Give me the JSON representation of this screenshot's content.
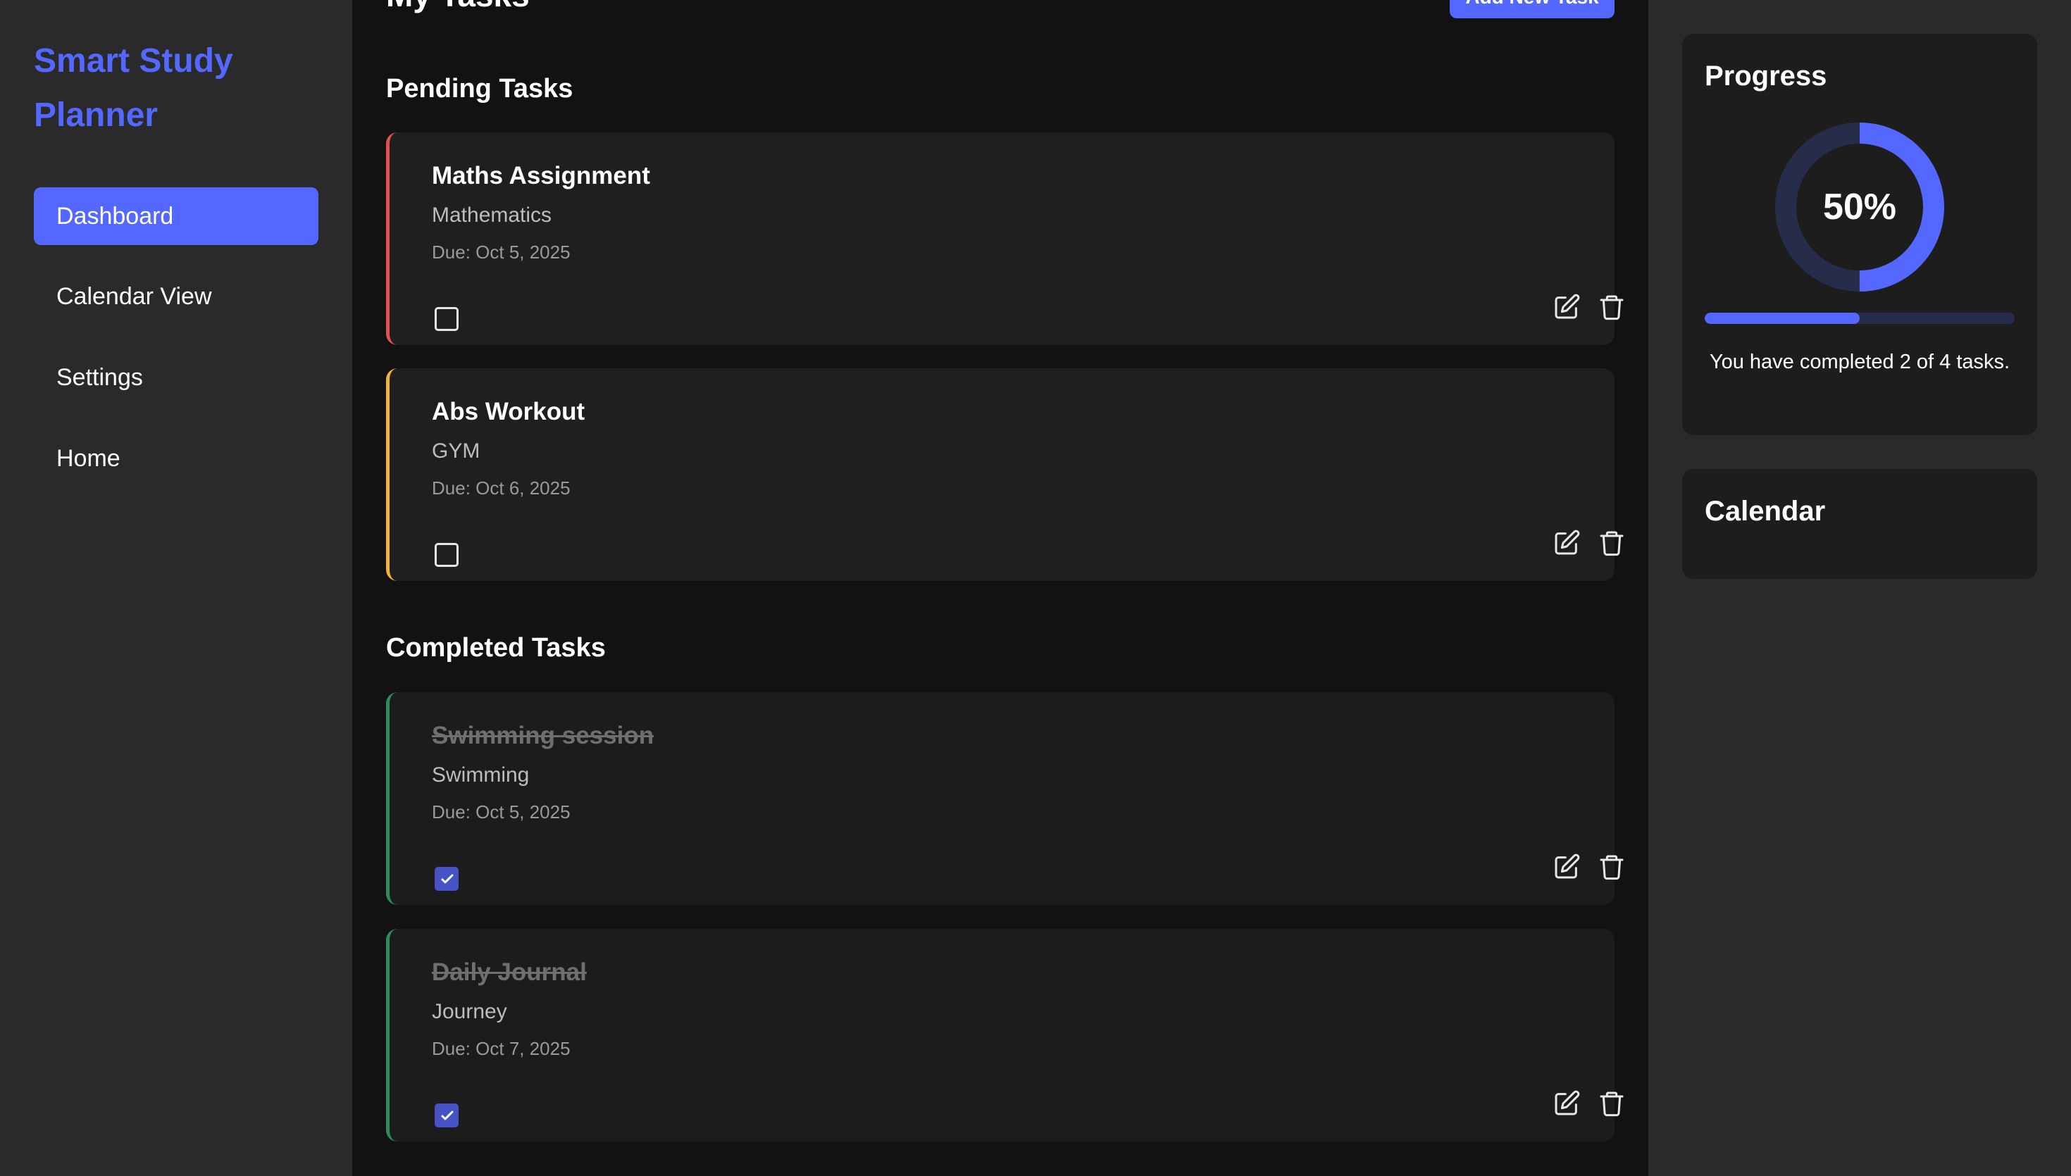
{
  "sidebar": {
    "brand": "Smart Study Planner",
    "items": [
      {
        "label": "Dashboard",
        "active": true
      },
      {
        "label": "Calendar View",
        "active": false
      },
      {
        "label": "Settings",
        "active": false
      },
      {
        "label": "Home",
        "active": false
      }
    ]
  },
  "main": {
    "title": "My Tasks",
    "add_button": "Add New Task",
    "pending_title": "Pending Tasks",
    "completed_title": "Completed Tasks",
    "pending": [
      {
        "title": "Maths Assignment",
        "subject": "Mathematics",
        "due": "Due: Oct 5, 2025",
        "accent": "#e05252",
        "checked": false
      },
      {
        "title": "Abs Workout",
        "subject": "GYM",
        "due": "Due: Oct 6, 2025",
        "accent": "#f0b43a",
        "checked": false
      }
    ],
    "completed": [
      {
        "title": "Swimming session",
        "subject": "Swimming",
        "due": "Due: Oct 5, 2025",
        "accent": "#2e8a5f",
        "checked": true
      },
      {
        "title": "Daily Journal",
        "subject": "Journey",
        "due": "Due: Oct 7, 2025",
        "accent": "#2e8a5f",
        "checked": true
      }
    ],
    "icons": {
      "edit": "edit-icon",
      "delete": "trash-icon",
      "check": "check-icon"
    }
  },
  "right": {
    "progress": {
      "title": "Progress",
      "percent_label": "50%",
      "fraction": 0.5,
      "text": "You have completed 2 of 4 tasks."
    },
    "calendar": {
      "title": "Calendar"
    }
  },
  "colors": {
    "accent": "#5468ff",
    "sidebar_bg": "#2a2a2a",
    "main_bg": "#121212",
    "card_bg": "#1f1f1f"
  }
}
